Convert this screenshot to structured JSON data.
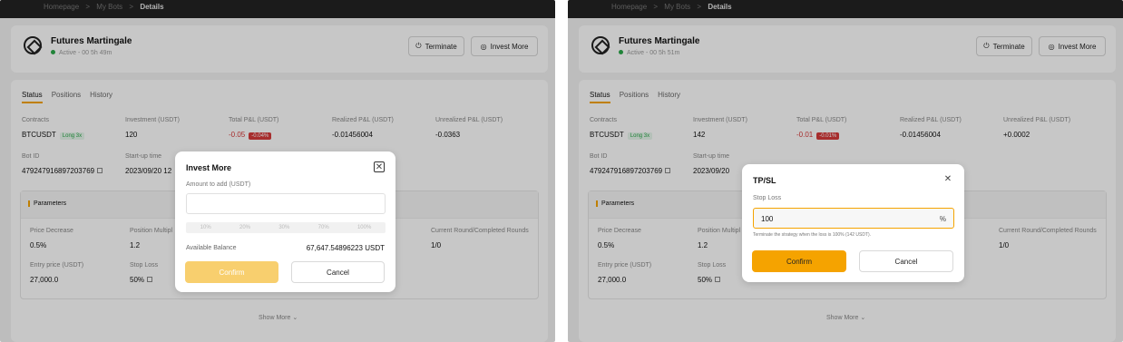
{
  "left": {
    "crumbs": [
      "Homepage",
      ">",
      "My Bots",
      ">",
      "Details"
    ],
    "bot": {
      "name": "Futures Martingale",
      "status": "Active - 00 5h 49m"
    },
    "actions": {
      "terminate": "Terminate",
      "invest": "Invest More"
    },
    "tabs": [
      "Status",
      "Positions",
      "History"
    ],
    "labels": {
      "contracts": "Contracts",
      "investment": "Investment (USDT)",
      "total_pnl": "Total P&L (USDT)",
      "realized": "Realized P&L (USDT)",
      "unrealized": "Unrealized P&L (USDT)",
      "bot_id": "Bot ID",
      "startup": "Start-up time"
    },
    "values": {
      "contract": "BTCUSDT",
      "contract_tag": "Long 3x",
      "investment": "120",
      "total_pnl": "-0.05",
      "total_pnl_pct": "-0.04%",
      "realized": "-0.01456004",
      "unrealized": "-0.0363",
      "bot_id": "479247916897203769",
      "startup": "2023/09/20 12"
    },
    "params": {
      "title": "Parameters",
      "price_decrease_label": "Price Decrease",
      "price_decrease": "0.5%",
      "position_mult_label": "Position Multipl",
      "position_mult": "1.2",
      "round_label": "Current Round/Completed Rounds",
      "round": "1/0",
      "entry_label": "Entry price (USDT)",
      "entry": "27,000.0",
      "stoploss_label": "Stop Loss",
      "stoploss": "50%"
    },
    "show_more": "Show More ⌄",
    "modal": {
      "title": "Invest More",
      "amount_label": "Amount to add (USDT)",
      "percents": [
        "10%",
        "20%",
        "30%",
        "70%",
        "100%"
      ],
      "balance_label": "Available Balance",
      "balance": "67,647.54896223 USDT",
      "confirm": "Confirm",
      "cancel": "Cancel"
    }
  },
  "right": {
    "crumbs": [
      "Homepage",
      ">",
      "My Bots",
      ">",
      "Details"
    ],
    "bot": {
      "name": "Futures Martingale",
      "status": "Active - 00 5h 51m"
    },
    "actions": {
      "terminate": "Terminate",
      "invest": "Invest More"
    },
    "tabs": [
      "Status",
      "Positions",
      "History"
    ],
    "labels": {
      "contracts": "Contracts",
      "investment": "Investment (USDT)",
      "total_pnl": "Total P&L (USDT)",
      "realized": "Realized P&L (USDT)",
      "unrealized": "Unrealized P&L (USDT)",
      "bot_id": "Bot ID",
      "startup": "Start-up time"
    },
    "values": {
      "contract": "BTCUSDT",
      "contract_tag": "Long 3x",
      "investment": "142",
      "total_pnl": "-0.01",
      "total_pnl_pct": "-0.01%",
      "realized": "-0.01456004",
      "unrealized": "+0.0002",
      "bot_id": "479247916897203769",
      "startup": "2023/09/20"
    },
    "params": {
      "title": "Parameters",
      "price_decrease_label": "Price Decrease",
      "price_decrease": "0.5%",
      "position_mult_label": "Position Multipl",
      "position_mult": "1.2",
      "round_label": "Current Round/Completed Rounds",
      "round": "1/0",
      "entry_label": "Entry price (USDT)",
      "entry": "27,000.0",
      "stoploss_label": "Stop Loss",
      "stoploss": "50%"
    },
    "show_more": "Show More ⌄",
    "modal": {
      "title": "TP/SL",
      "close": "✕",
      "stoploss_label": "Stop Loss",
      "value": "100",
      "unit": "%",
      "hint": "Terminate the strategy when the loss is 100% (142 USDT).",
      "confirm": "Confirm",
      "cancel": "Cancel"
    }
  }
}
